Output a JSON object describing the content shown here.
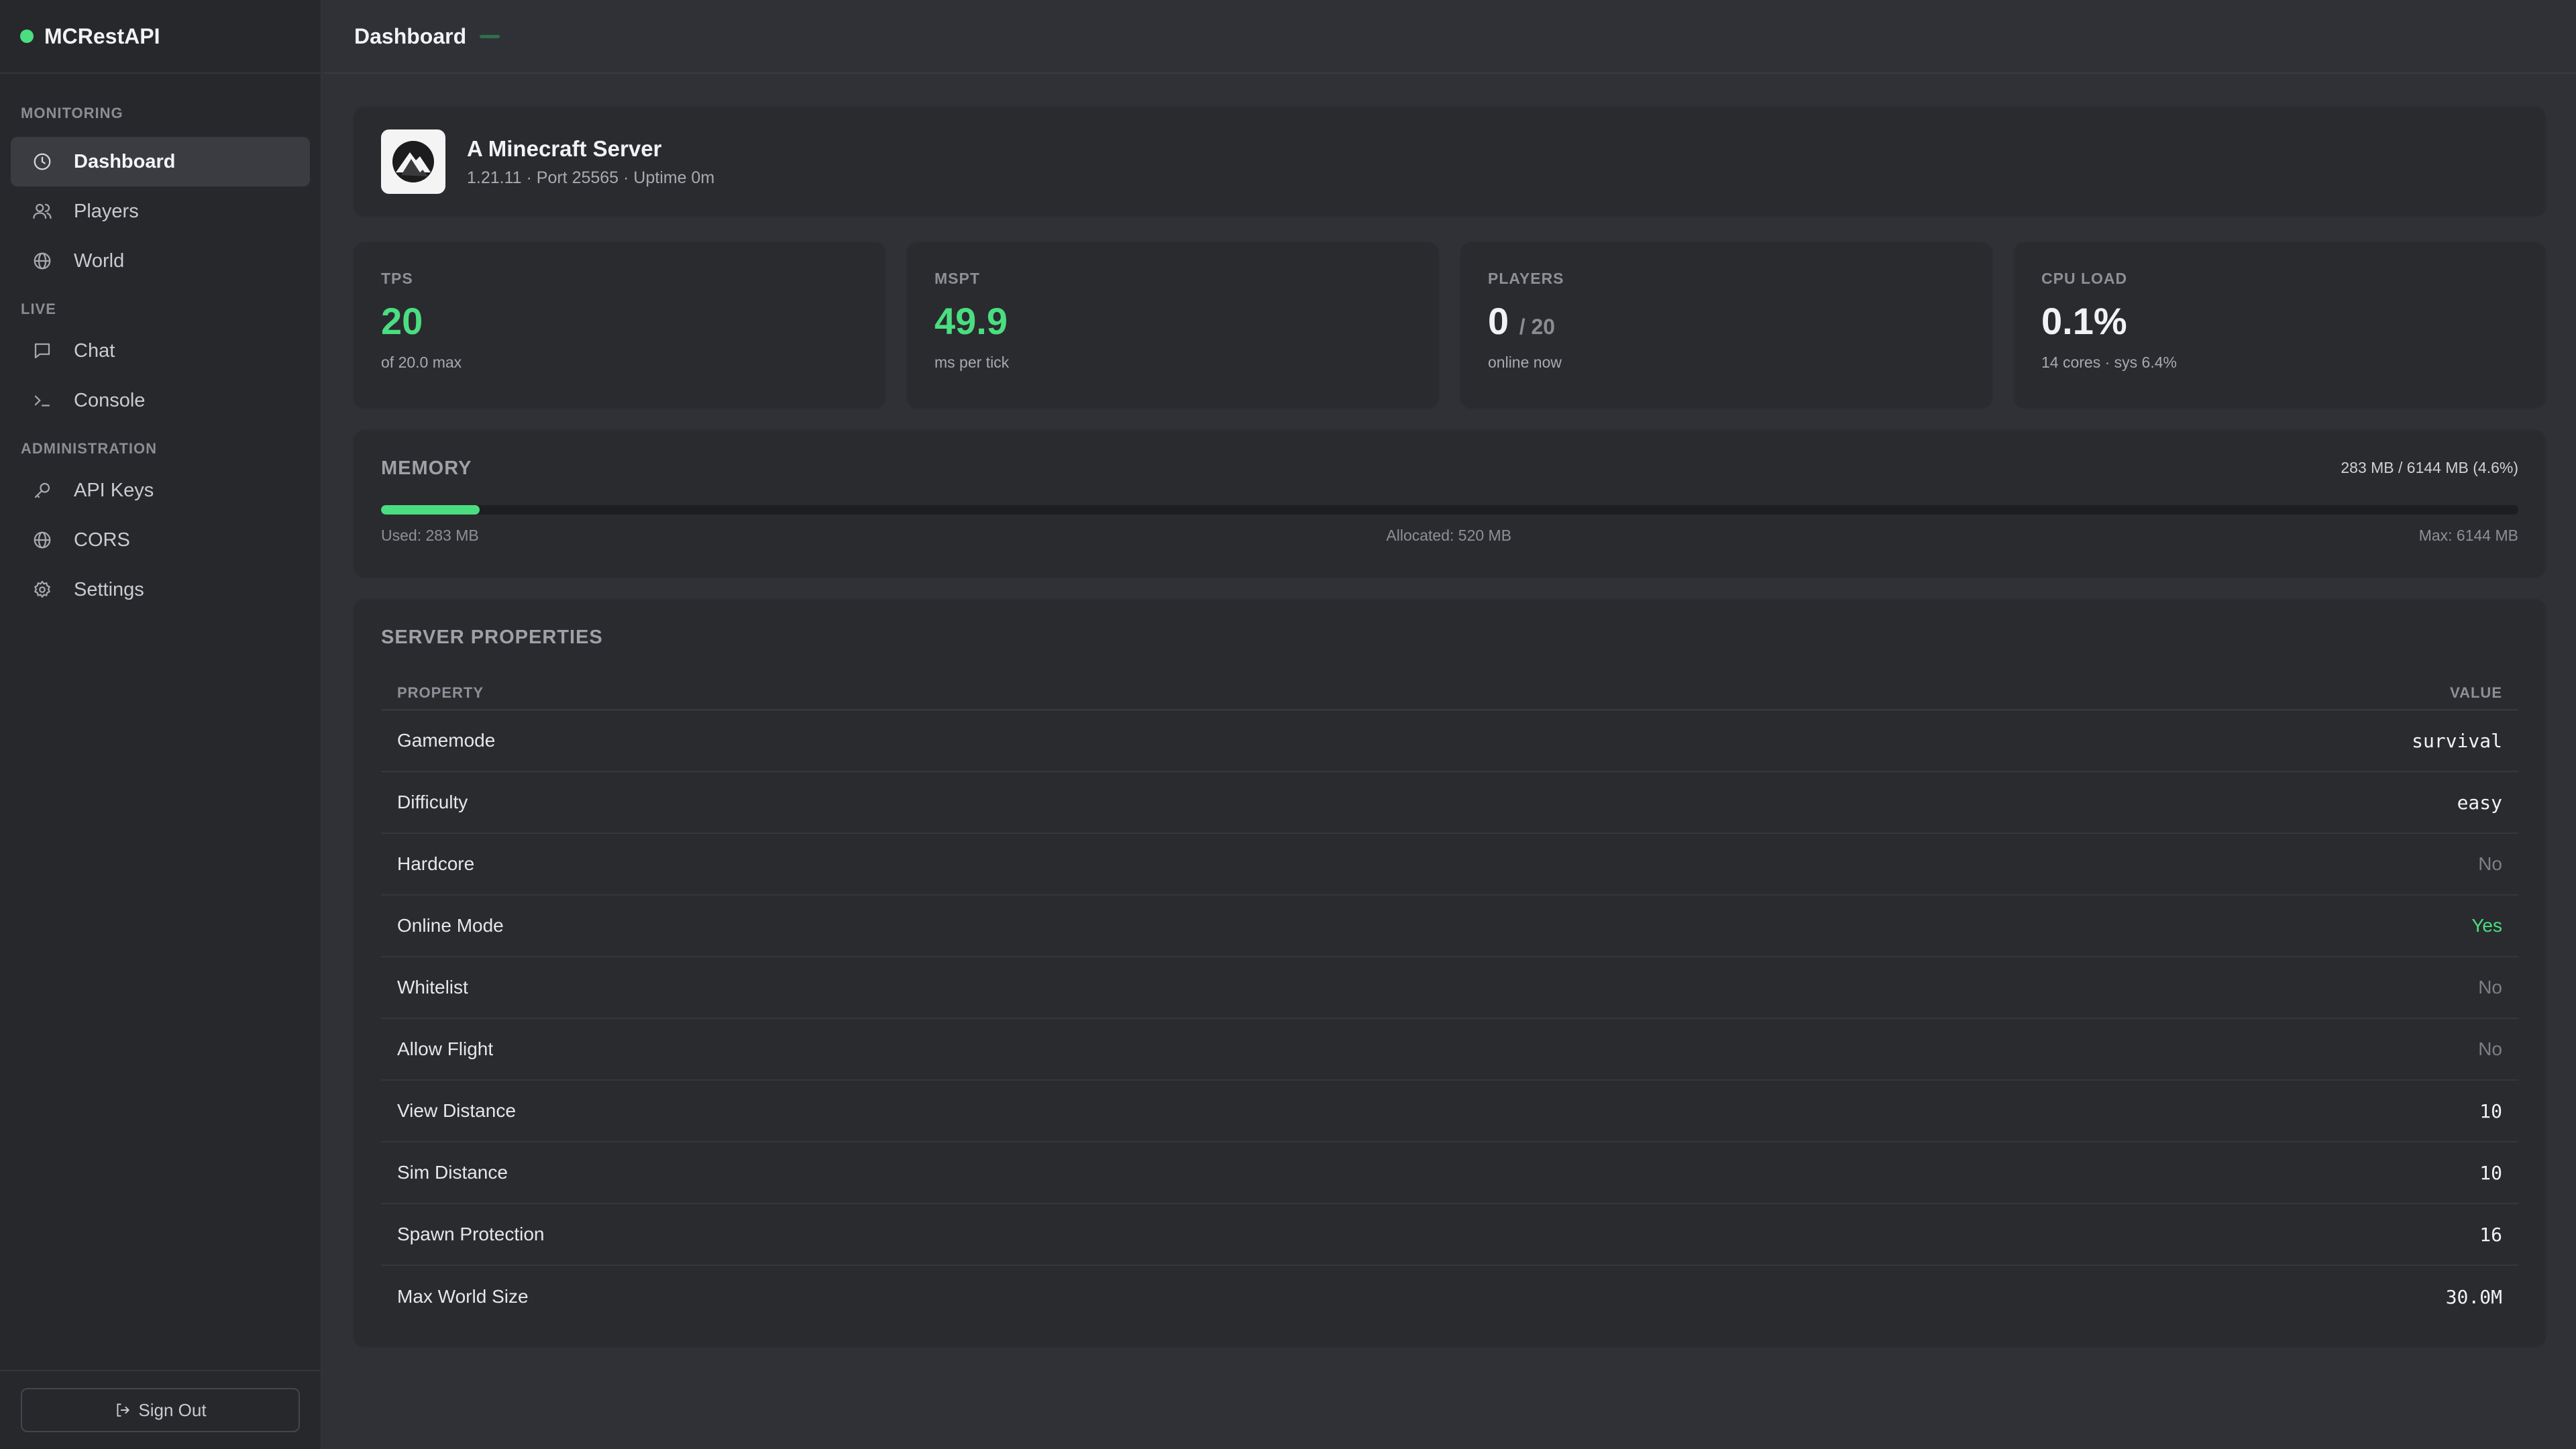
{
  "app": {
    "name": "MCRestAPI",
    "status_color": "#4ade80"
  },
  "sidebar": {
    "sections": [
      {
        "heading": "MONITORING",
        "items": [
          {
            "label": "Dashboard",
            "icon": "clock-icon",
            "active": true
          },
          {
            "label": "Players",
            "icon": "users-icon"
          },
          {
            "label": "World",
            "icon": "globe-icon"
          }
        ]
      },
      {
        "heading": "LIVE",
        "items": [
          {
            "label": "Chat",
            "icon": "chat-icon"
          },
          {
            "label": "Console",
            "icon": "terminal-icon"
          }
        ]
      },
      {
        "heading": "ADMINISTRATION",
        "items": [
          {
            "label": "API Keys",
            "icon": "key-icon"
          },
          {
            "label": "CORS",
            "icon": "globe-icon"
          },
          {
            "label": "Settings",
            "icon": "gear-icon"
          }
        ]
      }
    ],
    "signout_label": "Sign Out"
  },
  "header": {
    "title": "Dashboard"
  },
  "server": {
    "name": "A Minecraft Server",
    "meta": "1.21.11 · Port 25565 · Uptime 0m"
  },
  "stats": {
    "tps": {
      "label": "TPS",
      "value": "20",
      "caption": "of 20.0 max"
    },
    "mspt": {
      "label": "MSPT",
      "value": "49.9",
      "caption": "ms per tick"
    },
    "players": {
      "label": "PLAYERS",
      "value": "0",
      "max": "/ 20",
      "caption": "online now"
    },
    "cpu": {
      "label": "CPU LOAD",
      "value": "0.1%",
      "caption": "14 cores · sys 6.4%"
    }
  },
  "memory": {
    "title": "MEMORY",
    "summary": "283 MB / 6144 MB (4.6%)",
    "used_fraction": 0.046,
    "used_label": "Used: 283 MB",
    "allocated_label": "Allocated: 520 MB",
    "max_label": "Max: 6144 MB"
  },
  "properties": {
    "title": "SERVER PROPERTIES",
    "col_property": "PROPERTY",
    "col_value": "VALUE",
    "rows": [
      {
        "name": "Gamemode",
        "value": "survival",
        "kind": "mono"
      },
      {
        "name": "Difficulty",
        "value": "easy",
        "kind": "mono"
      },
      {
        "name": "Hardcore",
        "value": "No",
        "kind": "no"
      },
      {
        "name": "Online Mode",
        "value": "Yes",
        "kind": "yes"
      },
      {
        "name": "Whitelist",
        "value": "No",
        "kind": "no"
      },
      {
        "name": "Allow Flight",
        "value": "No",
        "kind": "no"
      },
      {
        "name": "View Distance",
        "value": "10",
        "kind": "mono"
      },
      {
        "name": "Sim Distance",
        "value": "10",
        "kind": "mono"
      },
      {
        "name": "Spawn Protection",
        "value": "16",
        "kind": "mono"
      },
      {
        "name": "Max World Size",
        "value": "30.0M",
        "kind": "mono"
      }
    ]
  }
}
